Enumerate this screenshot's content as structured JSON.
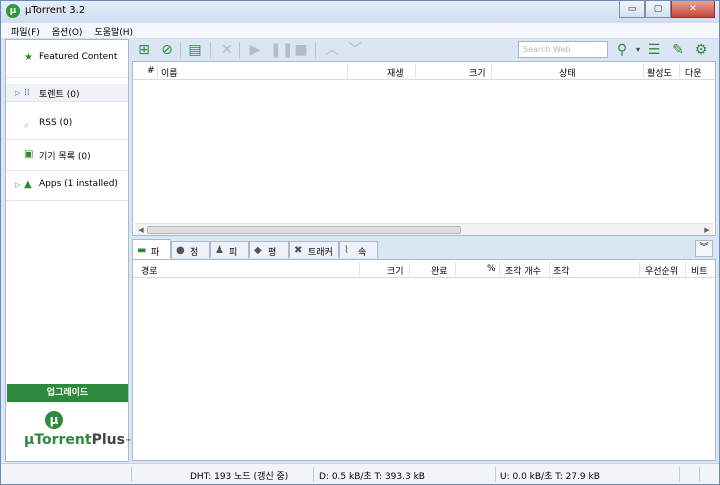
{
  "window": {
    "title": "µTorrent 3.2"
  },
  "window_controls": {
    "minimize": "▭",
    "maximize": "▢",
    "close": "✕"
  },
  "menu": [
    {
      "label": "파일(F)"
    },
    {
      "label": "옵션(O)"
    },
    {
      "label": "도움말(H)"
    }
  ],
  "sidebar": {
    "items": [
      {
        "label": "Featured Content",
        "icon": "star-icon"
      },
      {
        "label": "토렌트 (0)",
        "icon": "torrents-icon"
      },
      {
        "label": "RSS (0)",
        "icon": "rss-icon"
      },
      {
        "label": "기기 목록 (0)",
        "icon": "device-icon"
      },
      {
        "label": "Apps (1 installed)",
        "icon": "apps-icon"
      }
    ],
    "upgrade_label": "업그레이드",
    "plus_logo": {
      "mu": "µ",
      "torrent": "Torrent",
      "plus": "Plus",
      "tm": "™"
    }
  },
  "toolbar": {
    "search_placeholder": "Search Web"
  },
  "torrent_list": {
    "columns": [
      "#",
      "이름",
      "재생",
      "크기",
      "상태",
      "활성도",
      "다운"
    ]
  },
  "detail": {
    "tabs": [
      {
        "label": "파일",
        "icon": "folder-icon"
      },
      {
        "label": "정보",
        "icon": "info-icon"
      },
      {
        "label": "피어",
        "icon": "peers-icon"
      },
      {
        "label": "평점",
        "icon": "ratings-icon"
      },
      {
        "label": "트래커",
        "icon": "trackers-icon"
      },
      {
        "label": "속도",
        "icon": "speed-icon"
      }
    ],
    "columns": [
      "경로",
      "크기",
      "완료",
      "%",
      "조각 개수",
      "조각",
      "우선순위",
      "비트"
    ]
  },
  "status": {
    "dht": "DHT: 193 노드 (갱신 중)",
    "download": "D: 0.5 kB/초 T: 393.3 kB",
    "upload": "U: 0.0 kB/초 T: 27.9 kB"
  },
  "colors": {
    "accent_green": "#2d8a3c",
    "frame_blue": "#dbe6f4"
  }
}
